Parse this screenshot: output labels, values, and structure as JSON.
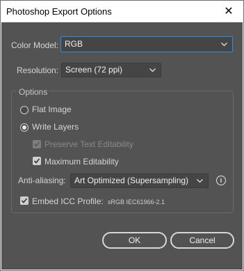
{
  "window": {
    "title": "Photoshop Export Options",
    "close_glyph": "✕"
  },
  "color_model": {
    "label": "Color Model:",
    "value": "RGB"
  },
  "resolution": {
    "label": "Resolution:",
    "value": "Screen (72 ppi)"
  },
  "options": {
    "group_title": "Options",
    "flat_image": {
      "label": "Flat Image",
      "selected": false
    },
    "write_layers": {
      "label": "Write Layers",
      "selected": true
    },
    "preserve_text": {
      "label": "Preserve Text Editability",
      "checked": true,
      "enabled": false
    },
    "maximum_editability": {
      "label": "Maximum Editability",
      "checked": true,
      "enabled": true
    },
    "anti_aliasing": {
      "label": "Anti-aliasing:",
      "value": "Art Optimized (Supersampling)"
    },
    "info_glyph": "i",
    "embed_icc": {
      "label": "Embed ICC Profile:",
      "checked": true,
      "profile": "sRGB IEC61966-2.1"
    }
  },
  "buttons": {
    "ok": "OK",
    "cancel": "Cancel"
  },
  "colors": {
    "panel_bg": "#535353",
    "focus_accent": "#2d8ceb",
    "title_bg": "#ffffff"
  }
}
